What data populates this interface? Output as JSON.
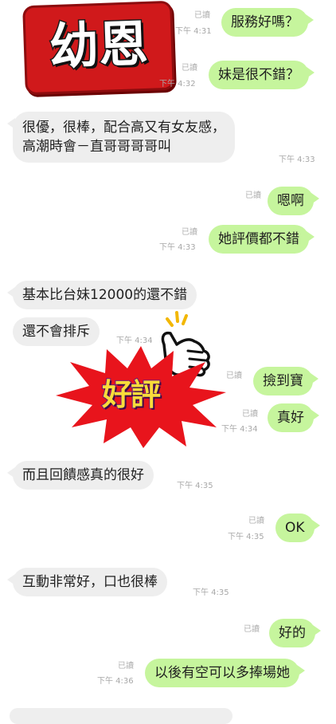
{
  "logo": {
    "text": "幼恩"
  },
  "stamp": {
    "text": "好評"
  },
  "messages": [
    {
      "side": "out",
      "read": "已讀",
      "time": "下午 4:31",
      "text": "服務好嗎？"
    },
    {
      "side": "out",
      "read": "已讀",
      "time": "下午 4:32",
      "text": "妹是很不錯？"
    },
    {
      "side": "in",
      "lines": [
        "很優，很棒，配合高又有女友感，",
        "高潮時會－直哥哥哥哥叫"
      ],
      "time": "下午 4:33"
    },
    {
      "side": "out",
      "read": "已讀",
      "text": "嗯啊"
    },
    {
      "side": "out",
      "read": "已讀",
      "time": "下午 4:33",
      "text": "她評價都不錯"
    },
    {
      "side": "in",
      "text": "基本比台妹12000的還不錯"
    },
    {
      "side": "in",
      "text": "還不會排斥",
      "time": "下午 4:34"
    },
    {
      "side": "out",
      "read": "已讀",
      "text": "撿到寶"
    },
    {
      "side": "out",
      "read": "已讀",
      "time": "下午 4:34",
      "text": "真好"
    },
    {
      "side": "in",
      "text": "而且回饋感真的很好",
      "time": "下午 4:35"
    },
    {
      "side": "out",
      "read": "已讀",
      "time": "下午 4:35",
      "text": "OK"
    },
    {
      "side": "in",
      "text": "互動非常好，口也很棒",
      "time": "下午 4:35"
    },
    {
      "side": "out",
      "read": "已讀",
      "text": "好的"
    },
    {
      "side": "out",
      "read": "已讀",
      "time": "下午 4:36",
      "text": "以後有空可以多捧場她"
    }
  ],
  "colors": {
    "outgoing_bubble": "#c6f59d",
    "incoming_bubble": "#eeeeee",
    "logo_red": "#d0191b",
    "stamp_red": "#e8141c"
  },
  "icons": [
    "thumbs-up-icon",
    "sparkle-lines-icon"
  ]
}
